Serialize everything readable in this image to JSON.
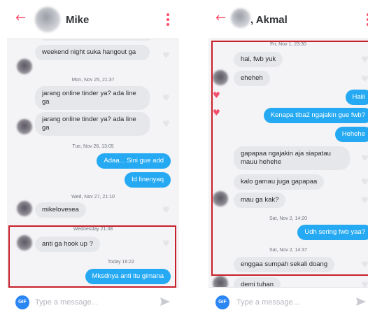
{
  "left": {
    "contact_name": "Mike",
    "input_placeholder": "Type a message...",
    "gif_label": "GIF",
    "stamps": {
      "s1": "Mon, Nov 25, 21:37",
      "s2": "Tue, Nov 26, 13:05",
      "s3": "Wed, Nov 27, 21:10",
      "s4": "Wednesday 21:38",
      "s5": "Today 16:22"
    },
    "messages": {
      "m1": "weekend night suka hangout ga",
      "m2": "jarang online tinder ya? ada line ga",
      "m3": "jarang online tinder ya? ada line ga",
      "m4": "Adaa... Sini gue add",
      "m5": "Id linenyaq",
      "m6": "mikelovesea",
      "m7": "anti ga hook up ?",
      "m8": "Mksdnya anti itu gimana"
    }
  },
  "right": {
    "contact_name": ", Akmal",
    "input_placeholder": "Type a message...",
    "gif_label": "GIF",
    "stamps": {
      "s1": "Fri, Nov 1, 23:30",
      "s2": "Sat, Nov 2, 14:20",
      "s3": "Sat, Nov 2, 14:37"
    },
    "messages": {
      "m1": "hai, fwb yuk",
      "m2": "eheheh",
      "m3": "Haiii",
      "m4": "Kenapa tiba2 ngajakin gue fwb?",
      "m5": "Hehehe",
      "m6": "gapapaa ngajakin aja siapatau mauu hehehe",
      "m7": "kalo gamau juga gapapaa",
      "m8": "mau ga kak?",
      "m9": "Udh sering fwb yaa?",
      "m10": "enggaa sumpah sekali doang",
      "m11": "demi tuhan"
    }
  },
  "colors": {
    "accent": "#fd5068",
    "outgoing_bubble": "#25a9f2",
    "incoming_bubble": "#e6e7ea",
    "highlight_box": "#c8202a",
    "gif_button": "#2b86f5"
  },
  "icons": [
    "back-arrow-icon",
    "kebab-menu-icon",
    "heart-icon",
    "send-icon",
    "gif-icon"
  ]
}
